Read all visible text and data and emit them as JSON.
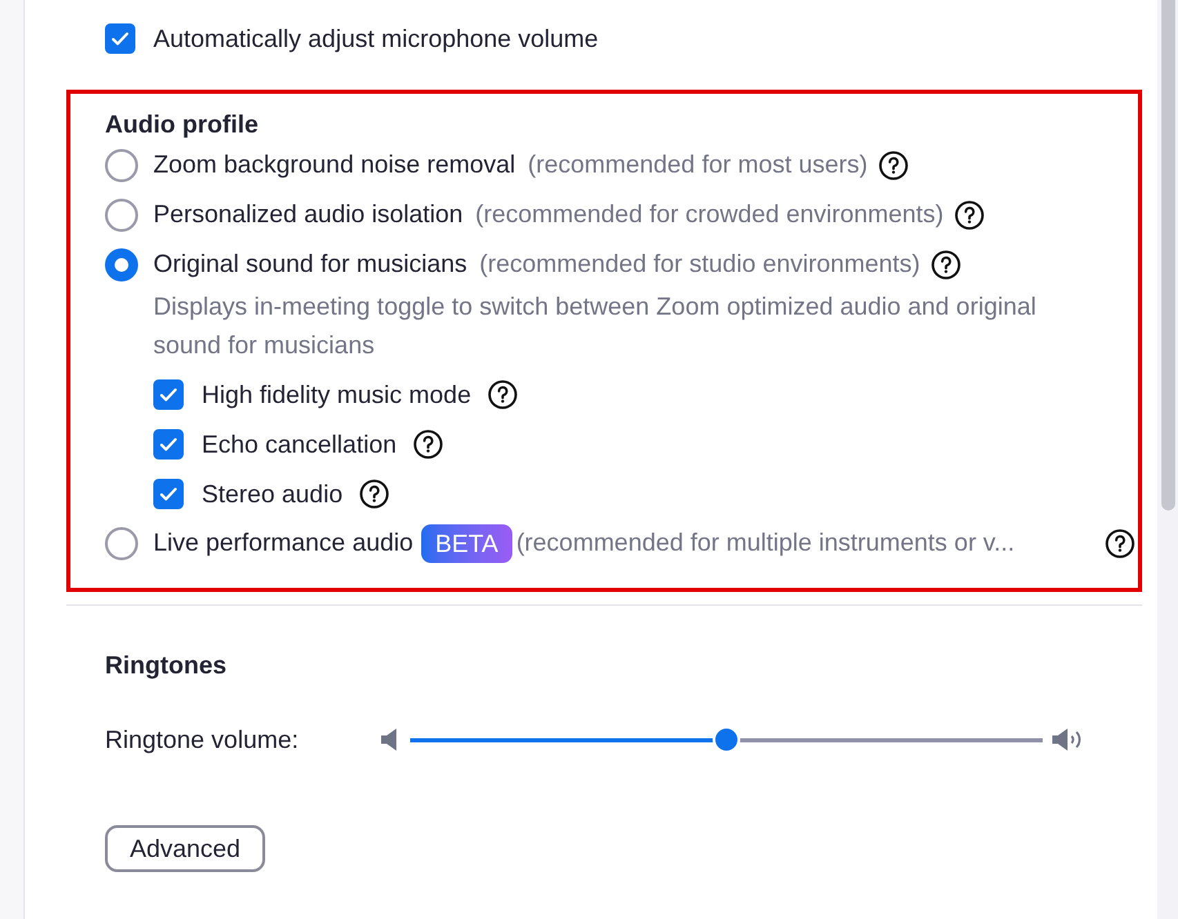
{
  "auto_adjust": {
    "label": "Automatically adjust microphone volume",
    "checked": true
  },
  "audio_profile": {
    "title": "Audio profile",
    "options": [
      {
        "label": "Zoom background noise removal",
        "hint": "(recommended for most users)",
        "selected": false
      },
      {
        "label": "Personalized audio isolation",
        "hint": "(recommended for crowded environments)",
        "selected": false
      },
      {
        "label": "Original sound for musicians",
        "hint": "(recommended for studio environments)",
        "selected": true,
        "description": "Displays in-meeting toggle to switch between Zoom optimized audio and original sound for musicians",
        "suboptions": [
          {
            "label": "High fidelity music mode",
            "checked": true
          },
          {
            "label": "Echo cancellation",
            "checked": true
          },
          {
            "label": "Stereo audio",
            "checked": true
          }
        ]
      },
      {
        "label": "Live performance audio",
        "badge": "BETA",
        "hint": "(recommended for multiple instruments or v...",
        "selected": false
      }
    ]
  },
  "ringtones": {
    "title": "Ringtones",
    "volume_label": "Ringtone volume:",
    "level": 0.5
  },
  "advanced_button": "Advanced"
}
